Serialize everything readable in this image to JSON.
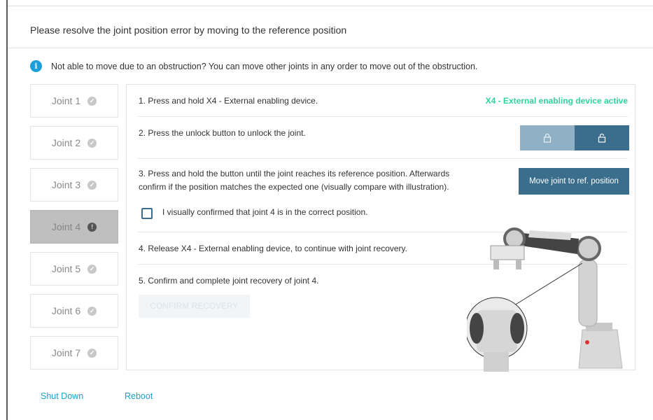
{
  "title": "Please resolve the joint position error by moving to the reference position",
  "info": {
    "icon": "info-icon",
    "text": "Not able to move due to an obstruction? You can move other joints in any order to move out of the obstruction."
  },
  "joints": [
    {
      "label": "Joint 1",
      "status": "ok"
    },
    {
      "label": "Joint 2",
      "status": "ok"
    },
    {
      "label": "Joint 3",
      "status": "ok"
    },
    {
      "label": "Joint 4",
      "status": "error"
    },
    {
      "label": "Joint 5",
      "status": "ok"
    },
    {
      "label": "Joint 6",
      "status": "ok"
    },
    {
      "label": "Joint 7",
      "status": "ok"
    }
  ],
  "steps": {
    "step1": "1. Press and hold X4 - External enabling device.",
    "step1_status": "X4 - External enabling device active",
    "step2": "2. Press the unlock button to unlock the joint.",
    "step3_line1": "3. Press and hold the button until the joint reaches its reference position. Afterwards",
    "step3_line2": "confirm if the position matches the expected one (visually compare with illustration).",
    "move_button": "Move joint to ref. position",
    "checkbox_label": "I visually confirmed that joint 4 is in the correct position.",
    "step4": "4. Release X4 - External enabling device, to continue with joint recovery.",
    "step5": "5. Confirm and complete joint recovery of joint 4.",
    "confirm_button": "CONFIRM RECOVERY"
  },
  "footer": {
    "shutdown": "Shut Down",
    "reboot": "Reboot"
  },
  "colors": {
    "accent": "#3b6d8c",
    "status_green": "#2ed3a0",
    "link": "#1aa3c9",
    "info_blue": "#1a9fd9"
  }
}
